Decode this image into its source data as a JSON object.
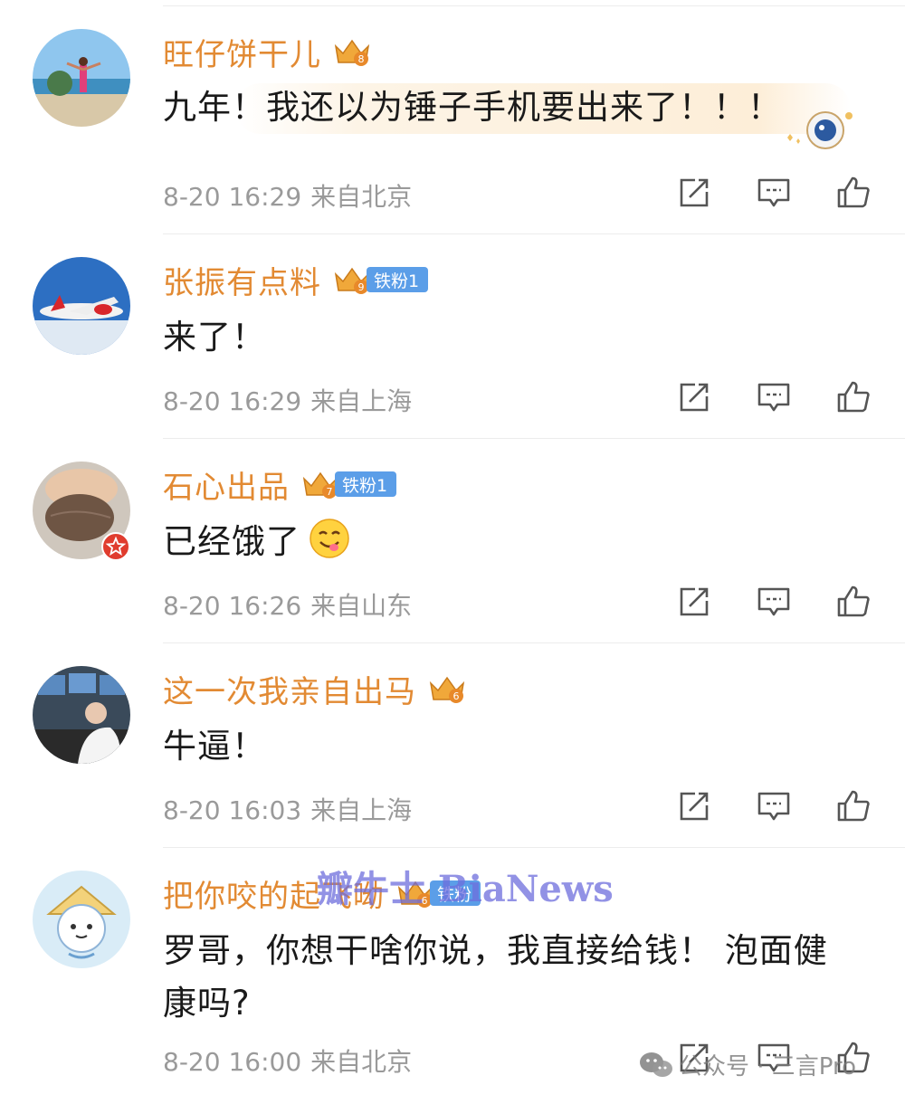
{
  "comments": [
    {
      "username": "旺仔饼干儿",
      "level": "8",
      "text": "九年！我还以为锤子手机要出来了！！！",
      "time": "8-20 16:29",
      "location": "来自北京"
    },
    {
      "username": "张振有点料",
      "level": "9",
      "fan_badge": "铁粉1",
      "text": "来了！",
      "time": "8-20 16:29",
      "location": "来自上海"
    },
    {
      "username": "石心出品",
      "level": "7",
      "fan_badge": "铁粉1",
      "text": "已经饿了",
      "time": "8-20 16:26",
      "location": "来自山东"
    },
    {
      "username": "这一次我亲自出马",
      "level": "6",
      "text": "牛逼！",
      "time": "8-20 16:03",
      "location": "来自上海"
    },
    {
      "username": "把你咬的起飞呦",
      "level": "6",
      "fan_badge": "铁粉",
      "text": "罗哥，你想干啥你说，我直接给钱！ 泡面健康吗?",
      "time": "8-20 16:00",
      "location": "来自北京"
    }
  ],
  "watermark": "瓣牛士 BiaNews",
  "wechat_watermark": "公众号 · 三言Pro",
  "icons": [
    "share-icon",
    "comment-icon",
    "like-icon"
  ],
  "colors": {
    "username": "#e28a33",
    "meta": "#9a9a9a",
    "fan_badge": "#5b9ee8",
    "crown": "#f0a83a"
  }
}
